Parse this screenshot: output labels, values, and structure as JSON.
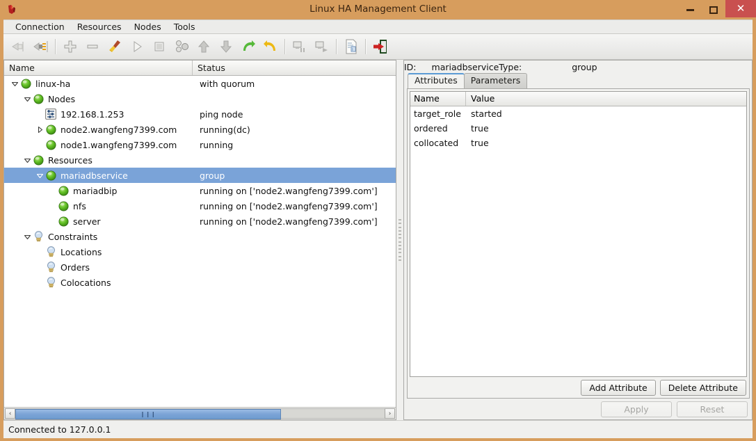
{
  "window": {
    "title": "Linux HA Management Client",
    "app_icon": "app-icon",
    "minimize_label": "–",
    "maximize_label": "□",
    "close_label": "✕"
  },
  "menubar": {
    "items": [
      {
        "label": "Connection"
      },
      {
        "label": "Resources"
      },
      {
        "label": "Nodes"
      },
      {
        "label": "Tools"
      }
    ]
  },
  "toolbar": {
    "items": [
      {
        "name": "connect-icon",
        "enabled": false
      },
      {
        "name": "disconnect-icon",
        "enabled": true
      },
      {
        "name": "separator"
      },
      {
        "name": "add-icon",
        "enabled": true
      },
      {
        "name": "remove-icon",
        "enabled": true
      },
      {
        "name": "cleanup-brush-icon",
        "enabled": true
      },
      {
        "name": "start-play-icon",
        "enabled": true
      },
      {
        "name": "stop-icon",
        "enabled": true
      },
      {
        "name": "manage-resources-icon",
        "enabled": true
      },
      {
        "name": "move-up-icon",
        "enabled": true
      },
      {
        "name": "move-down-icon",
        "enabled": true
      },
      {
        "name": "migrate-icon",
        "enabled": true
      },
      {
        "name": "unmigrate-undo-icon",
        "enabled": true
      },
      {
        "name": "separator"
      },
      {
        "name": "standby-node-icon",
        "enabled": true
      },
      {
        "name": "activate-node-icon",
        "enabled": true
      },
      {
        "name": "separator"
      },
      {
        "name": "cib-document-icon",
        "enabled": true
      },
      {
        "name": "separator"
      },
      {
        "name": "exit-icon",
        "enabled": true
      }
    ]
  },
  "tree": {
    "columns": {
      "name": "Name",
      "status": "Status"
    },
    "rows": [
      {
        "label": "linux-ha",
        "status": "with quorum",
        "indent": 0,
        "twisty": "down",
        "icon": "green-ball-icon",
        "selected": false
      },
      {
        "label": "Nodes",
        "status": "",
        "indent": 1,
        "twisty": "down",
        "icon": "green-ball-icon",
        "selected": false
      },
      {
        "label": "192.168.1.253",
        "status": "ping node",
        "indent": 2,
        "twisty": "none",
        "icon": "ping-node-icon",
        "selected": false
      },
      {
        "label": "node2.wangfeng7399.com",
        "status": "running(dc)",
        "indent": 2,
        "twisty": "right",
        "icon": "green-ball-icon",
        "selected": false
      },
      {
        "label": "node1.wangfeng7399.com",
        "status": "running",
        "indent": 2,
        "twisty": "none",
        "icon": "green-ball-icon",
        "selected": false
      },
      {
        "label": "Resources",
        "status": "",
        "indent": 1,
        "twisty": "down",
        "icon": "green-ball-icon",
        "selected": false
      },
      {
        "label": "mariadbservice",
        "status": "group",
        "indent": 2,
        "twisty": "down",
        "icon": "green-ball-icon",
        "selected": true
      },
      {
        "label": "mariadbip",
        "status": "running on ['node2.wangfeng7399.com']",
        "indent": 3,
        "twisty": "none",
        "icon": "green-ball-icon",
        "selected": false
      },
      {
        "label": "nfs",
        "status": "running on ['node2.wangfeng7399.com']",
        "indent": 3,
        "twisty": "none",
        "icon": "green-ball-icon",
        "selected": false
      },
      {
        "label": "server",
        "status": "running on ['node2.wangfeng7399.com']",
        "indent": 3,
        "twisty": "none",
        "icon": "green-ball-icon",
        "selected": false
      },
      {
        "label": "Constraints",
        "status": "",
        "indent": 1,
        "twisty": "down",
        "icon": "bulb-icon",
        "selected": false
      },
      {
        "label": "Locations",
        "status": "",
        "indent": 2,
        "twisty": "none",
        "icon": "bulb-icon",
        "selected": false
      },
      {
        "label": "Orders",
        "status": "",
        "indent": 2,
        "twisty": "none",
        "icon": "bulb-icon",
        "selected": false
      },
      {
        "label": "Colocations",
        "status": "",
        "indent": 2,
        "twisty": "none",
        "icon": "bulb-icon",
        "selected": false
      }
    ],
    "hscroll": {
      "left_arrow": "‹",
      "right_arrow": "›",
      "thumb_grip": "❙❙❙"
    }
  },
  "details": {
    "id_label": "ID:",
    "id_value": "mariadbservice",
    "type_label": "Type:",
    "type_value": "group",
    "tabs": [
      {
        "label": "Attributes",
        "active": true
      },
      {
        "label": "Parameters",
        "active": false
      }
    ],
    "attributes_table": {
      "columns": [
        "Name",
        "Value"
      ],
      "rows": [
        {
          "name": "target_role",
          "value": "started"
        },
        {
          "name": "ordered",
          "value": "true"
        },
        {
          "name": "collocated",
          "value": "true"
        }
      ]
    },
    "buttons": {
      "add_attribute": "Add Attribute",
      "delete_attribute": "Delete Attribute",
      "apply": "Apply",
      "reset": "Reset"
    }
  },
  "statusbar": {
    "text": "Connected to 127.0.0.1"
  },
  "colors": {
    "titlebar": "#d79d5d",
    "close_button": "#c9504f",
    "selection": "#7aa3d8",
    "active_tab_accent": "#5b9bd5",
    "node_green": "#6cc13a"
  }
}
